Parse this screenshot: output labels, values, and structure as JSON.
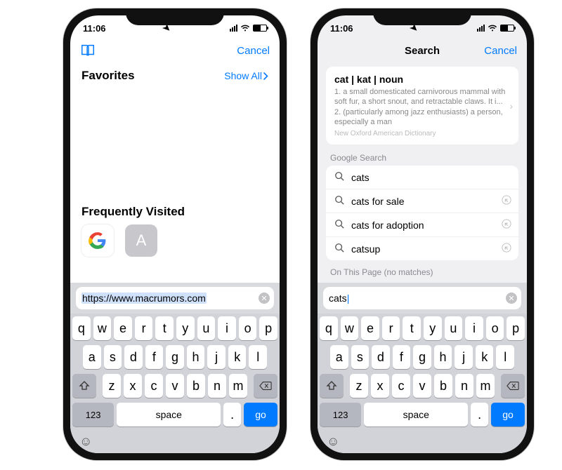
{
  "status": {
    "time": "11:06",
    "battery_pct": 55
  },
  "left": {
    "cancel": "Cancel",
    "favorites_label": "Favorites",
    "show_all": "Show All",
    "freq_label": "Frequently Visited",
    "tile_letter": "A",
    "url_value": "https://www.macrumors.com"
  },
  "right": {
    "title": "Search",
    "cancel": "Cancel",
    "card": {
      "head": "cat | kat | noun",
      "body": "1. a small domesticated carnivorous mammal with soft fur, a short snout, and retractable claws. It i...\n2. (particularly among jazz enthusiasts) a person, especially a man",
      "source": "New Oxford American Dictionary"
    },
    "google_label": "Google Search",
    "suggestions": [
      "cats",
      "cats for sale",
      "cats for adoption",
      "catsup"
    ],
    "onpage_label": "On This Page (no matches)",
    "search_value": "cats"
  },
  "keyboard": {
    "rows": [
      [
        "q",
        "w",
        "e",
        "r",
        "t",
        "y",
        "u",
        "i",
        "o",
        "p"
      ],
      [
        "a",
        "s",
        "d",
        "f",
        "g",
        "h",
        "j",
        "k",
        "l"
      ],
      [
        "z",
        "x",
        "c",
        "v",
        "b",
        "n",
        "m"
      ]
    ],
    "num": "123",
    "space": "space",
    "dot": ".",
    "go": "go"
  }
}
